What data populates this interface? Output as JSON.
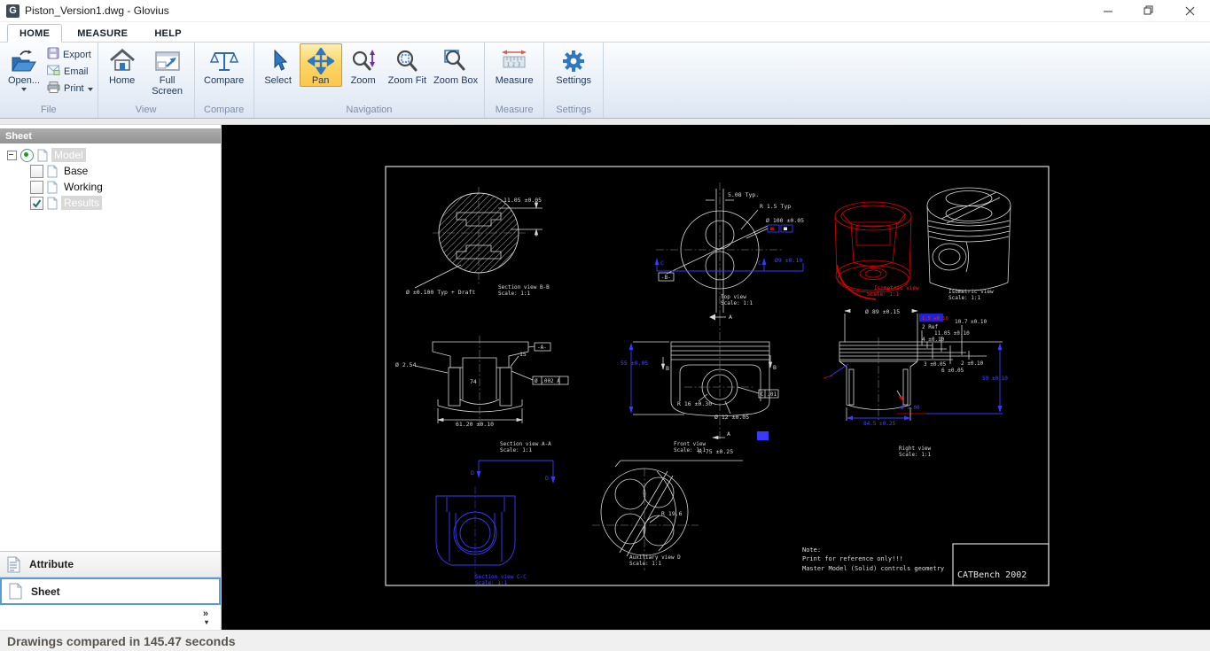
{
  "window": {
    "title": "Piston_Version1.dwg - Glovius",
    "icon_letter": "G"
  },
  "tabs": [
    {
      "label": "HOME"
    },
    {
      "label": "MEASURE"
    },
    {
      "label": "HELP"
    }
  ],
  "ribbon": {
    "open": "Open...",
    "export": "Export",
    "email": "Email",
    "print": "Print",
    "home": "Home",
    "fullscreen": "Full Screen",
    "compare": "Compare",
    "select": "Select",
    "pan": "Pan",
    "zoom": "Zoom",
    "zoomfit": "Zoom Fit",
    "zoombox": "Zoom Box",
    "measure": "Measure",
    "settings": "Settings",
    "groups": {
      "file": "File",
      "view": "View",
      "compare": "Compare",
      "navigation": "Navigation",
      "measure": "Measure",
      "settings": "Settings"
    }
  },
  "sidebar": {
    "header": "Sheet",
    "tree": {
      "root": "Model",
      "children": [
        {
          "label": "Base",
          "checked": false
        },
        {
          "label": "Working",
          "checked": false
        },
        {
          "label": "Results",
          "checked": true
        }
      ]
    },
    "panels": {
      "attribute": "Attribute",
      "sheet": "Sheet"
    },
    "chevron": "»",
    "chevron_caret": "▾"
  },
  "statusbar": {
    "text": "Drawings compared in 145.47 seconds"
  },
  "drawing": {
    "bb": {
      "title": "Section view B-B",
      "scale": "Scale: 1:1",
      "dim1": "11.05 ±0.05",
      "note": "Ø ±0.100 Typ + Draft"
    },
    "top": {
      "title": "Top view",
      "scale": "Scale: 1:1",
      "dim1": "5.08 Typ.",
      "dim2": "R 1.5 Typ",
      "dim3": "Ø 100 ±0.05",
      "dim4": "Ø9 ±0.10",
      "datum": "-B-",
      "marker": "C",
      "arrow": "A"
    },
    "iso_red": {
      "title": "Isometric view",
      "scale": "Scale: 1:1"
    },
    "iso_white": {
      "title": "Isometric view",
      "scale": "Scale: 1:1"
    },
    "aa": {
      "title": "Section view A-A",
      "scale": "Scale: 1:1",
      "dim1": "Ø 2.54",
      "dim2": "15",
      "dim3": "74",
      "dim4": "61.20 ±0.10",
      "datum": "-A-",
      "fcf": "Ø .002 A"
    },
    "front": {
      "title": "Front view",
      "scale": "Scale: 1:1",
      "dim1": "55 ±0.05",
      "dim2": "R 16 ±0.30",
      "dim3": "Ø 12 ±0.05",
      "dim4": "R 75 ±0.25",
      "fcf": "C .01",
      "marker_b": "B",
      "marker_a": "A"
    },
    "right": {
      "title": "Right view",
      "scale": "Scale: 1:1",
      "dim1": "Ø 89 ±0.15",
      "sel": "1.5 ±0.10",
      "dim2": "2 Ref",
      "dim3": "11.05 ±0.10",
      "dim4": "10.7 ±0.10",
      "dim5": "4 ±0.10",
      "dim6": "3 ±0.05",
      "dim7": "6 ±0.05",
      "dim8": "2 ±0.10",
      "dim9": "59 ±0.10",
      "dim10": "Ø 5.00",
      "dim11": "84.5 ±0.25"
    },
    "cc": {
      "title": "Section view C-C",
      "scale": "Scale: 1:1",
      "marker": "D"
    },
    "aux": {
      "title": "Auxiliary view D",
      "scale": "Scale: 1:1",
      "dim1": "R 19.6"
    },
    "note": {
      "l1": "Note:",
      "l2": "Print for reference only!!!",
      "l3": "Master Model (Solid) controls geometry"
    },
    "titleblock": "CATBench 2002"
  }
}
